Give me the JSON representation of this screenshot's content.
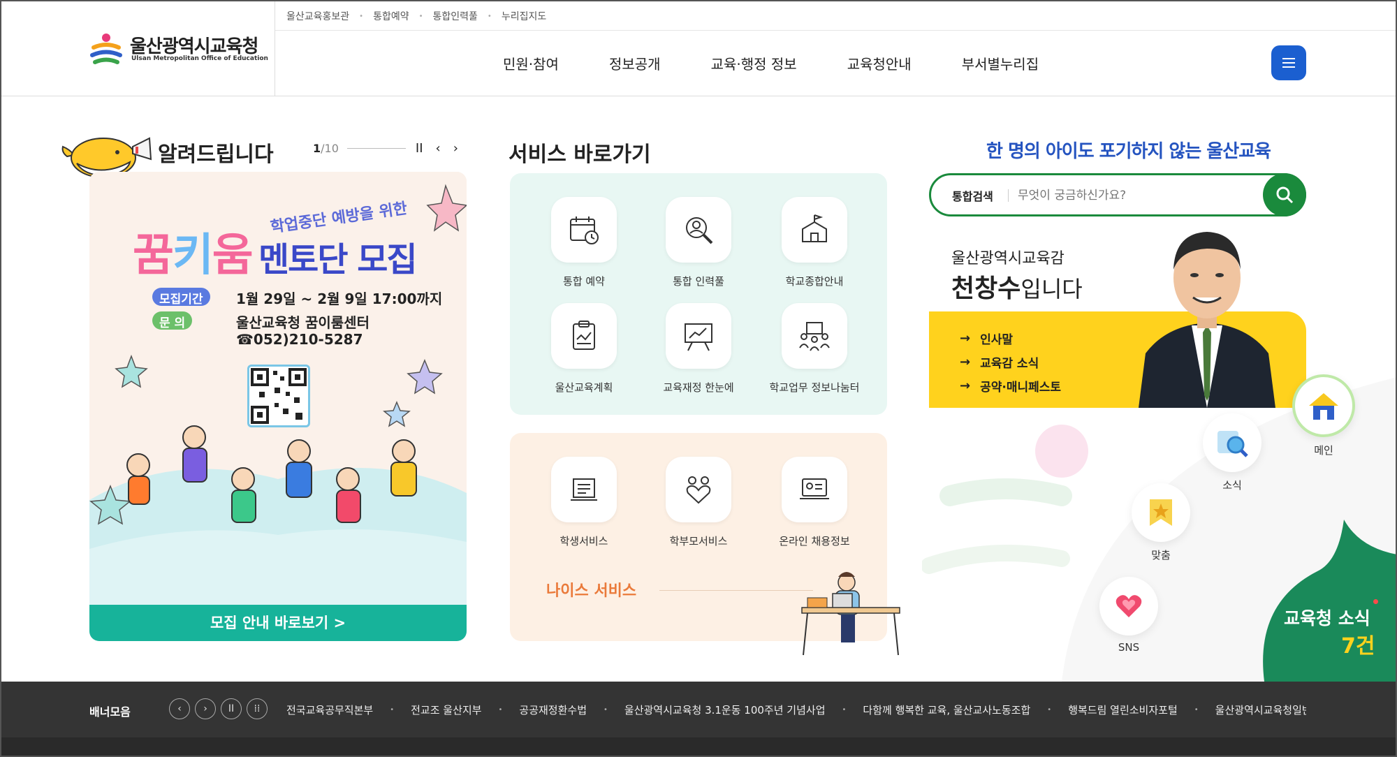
{
  "header": {
    "logo_title": "울산광역시교육청",
    "logo_subtitle": "Ulsan Metropolitan Office of Education",
    "util_links": [
      "울산교육홍보관",
      "통합예약",
      "통합인력풀",
      "누리집지도"
    ],
    "gnb": [
      "민원·참여",
      "정보공개",
      "교육·행정 정보",
      "교육청안내",
      "부서별누리집"
    ]
  },
  "notice": {
    "title": "알려드립니다",
    "page_current": "1",
    "page_total": "/10",
    "pause": "II",
    "prev": "‹",
    "next": "›"
  },
  "banner": {
    "tag": "학업중단 예방을 위한",
    "title_a": "꿈",
    "title_b": "키",
    "title_c": "움",
    "title_2": "멘토단 모집",
    "pill1": "모집기간",
    "info1": "1월 29일 ~ 2월 9일 17:00까지",
    "pill2": "문     의",
    "info2": "울산교육청 꿈이룸센터",
    "info3": "☎052)210-5287",
    "cta": "모집 안내 바로보기 >"
  },
  "services": {
    "title": "서비스 바로가기",
    "group1": [
      {
        "label": "통합 예약",
        "icon": "calendar-clock-icon"
      },
      {
        "label": "통합 인력풀",
        "icon": "person-search-icon"
      },
      {
        "label": "학교종합안내",
        "icon": "school-flag-icon"
      },
      {
        "label": "울산교육계획",
        "icon": "clipboard-chart-icon"
      },
      {
        "label": "교육재정 한눈에",
        "icon": "presentation-chart-icon"
      },
      {
        "label": "학교업무 정보나눔터",
        "icon": "team-meeting-icon"
      }
    ],
    "group2": [
      {
        "label": "학생서비스",
        "icon": "student-book-icon"
      },
      {
        "label": "학부모서비스",
        "icon": "family-heart-icon"
      },
      {
        "label": "온라인 채용정보",
        "icon": "laptop-id-icon"
      }
    ],
    "neis": "나이스 서비스"
  },
  "right": {
    "slogan": "한 명의 아이도 포기하지 않는 울산교육",
    "search_label": "통합검색",
    "search_placeholder": "무엇이 궁금하신가요?",
    "supt_sub": "울산광역시교육감",
    "supt_name": "천창수",
    "supt_suffix": "입니다",
    "links": [
      "인사말",
      "교육감 소식",
      "공약·매니페스토"
    ]
  },
  "quick": [
    {
      "label": "메인",
      "icon": "home-icon"
    },
    {
      "label": "소식",
      "icon": "news-search-icon"
    },
    {
      "label": "맞춤",
      "icon": "bookmark-star-icon"
    },
    {
      "label": "SNS",
      "icon": "heart-icon"
    }
  ],
  "news": {
    "title": "교육청 소식",
    "count": "7건"
  },
  "footer": {
    "title": "배너모음",
    "links": [
      "전국교육공무직본부",
      "전교조 울산지부",
      "공공재정환수법",
      "울산광역시교육청 3.1운동 100주년 기념사업",
      "다함께 행복한 교육, 울산교사노동조합",
      "행복드림 열린소비자포털",
      "울산광역시교육청일반직공무"
    ]
  },
  "colors": {
    "brand_blue": "#1b5fd0",
    "search_green": "#1a8a3c",
    "yellow": "#ffd21d",
    "service_mint": "#e8f7f3",
    "service_peach": "#fdf0e4",
    "neis_orange": "#ea7a3a",
    "footer_dark": "#343434"
  }
}
